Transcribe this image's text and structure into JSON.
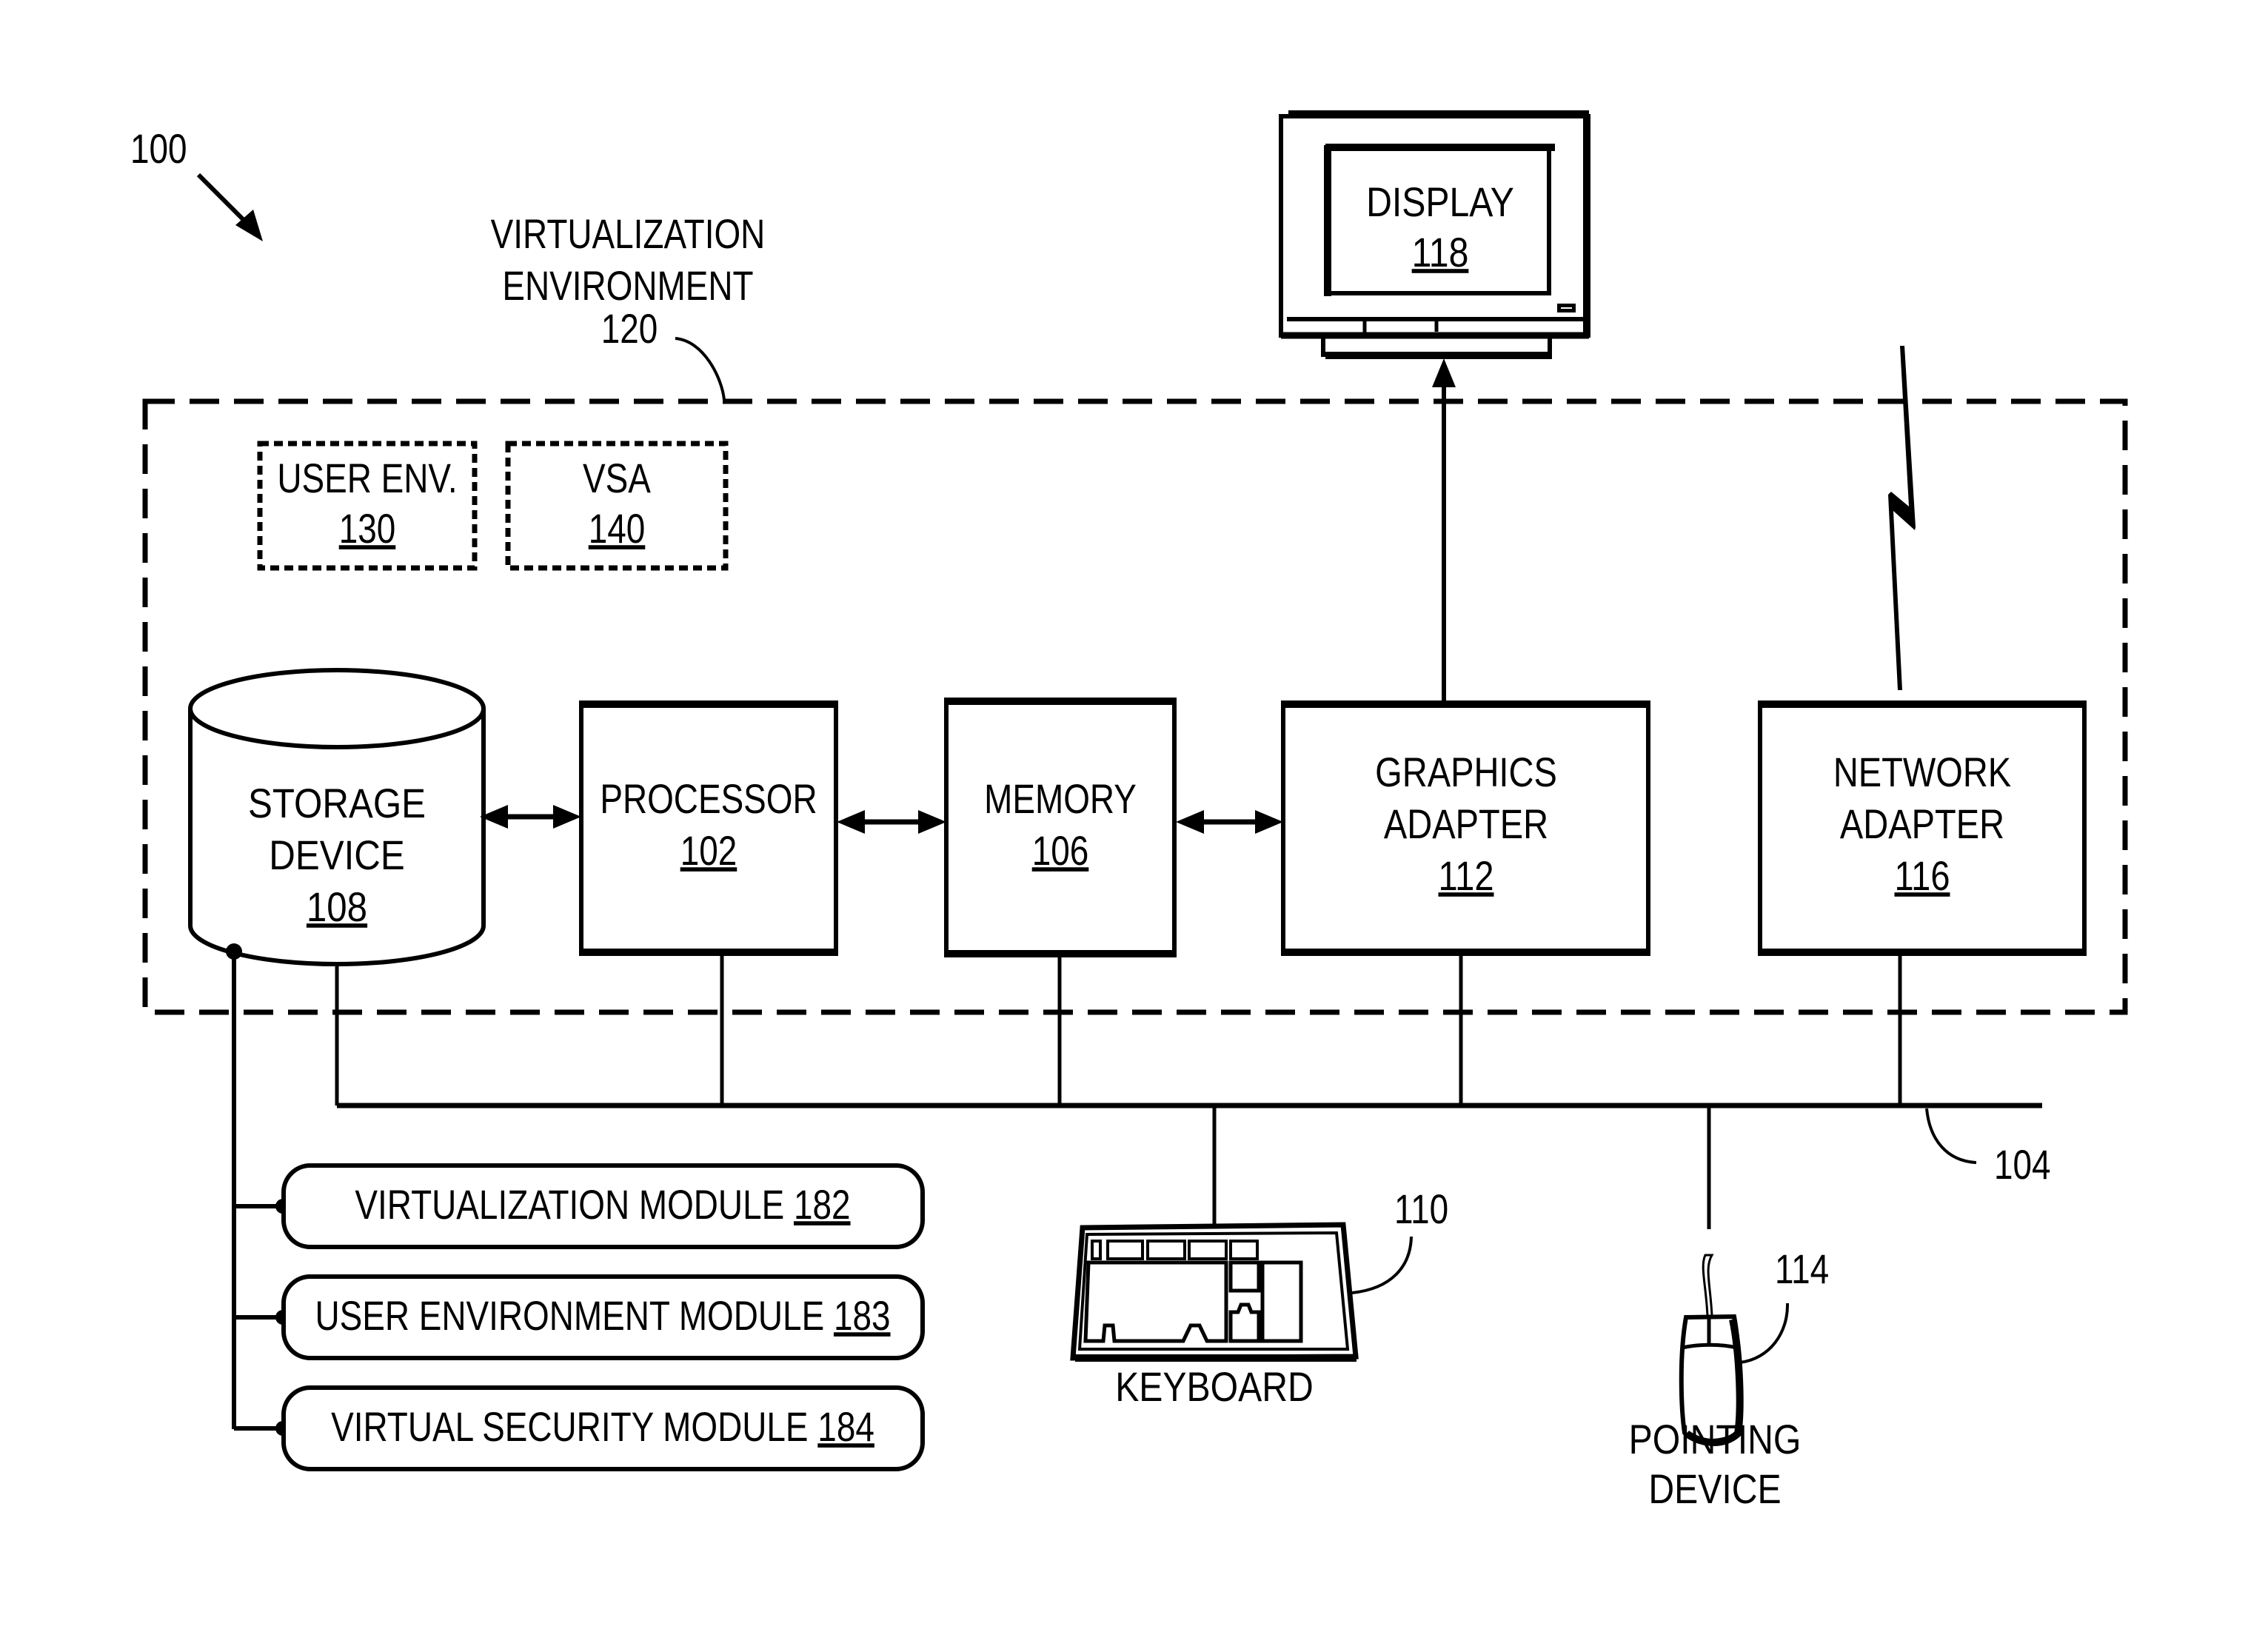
{
  "figure": {
    "ref": "100",
    "virtualization_environment": {
      "line1": "VIRTUALIZATION",
      "line2": "ENVIRONMENT",
      "ref": "120"
    },
    "user_env": {
      "label": "USER ENV.",
      "ref": "130"
    },
    "vsa": {
      "label": "VSA",
      "ref": "140"
    },
    "storage": {
      "line1": "STORAGE",
      "line2": "DEVICE",
      "ref": "108"
    },
    "processor": {
      "label": "PROCESSOR",
      "ref": "102"
    },
    "memory": {
      "label": "MEMORY",
      "ref": "106"
    },
    "graphics": {
      "line1": "GRAPHICS",
      "line2": "ADAPTER",
      "ref": "112"
    },
    "network": {
      "line1": "NETWORK",
      "line2": "ADAPTER",
      "ref": "116"
    },
    "display": {
      "label": "DISPLAY",
      "ref": "118"
    },
    "bus": {
      "ref": "104"
    },
    "keyboard": {
      "label": "KEYBOARD",
      "ref": "110"
    },
    "pointing": {
      "line1": "POINTING",
      "line2": "DEVICE",
      "ref": "114"
    },
    "modules": [
      {
        "label": "VIRTUALIZATION MODULE ",
        "ref": "182"
      },
      {
        "label": "USER ENVIRONMENT MODULE ",
        "ref": "183"
      },
      {
        "label": "VIRTUAL SECURITY MODULE ",
        "ref": "184"
      }
    ],
    "colors": {
      "ink": "#000000",
      "background": "#ffffff"
    }
  }
}
